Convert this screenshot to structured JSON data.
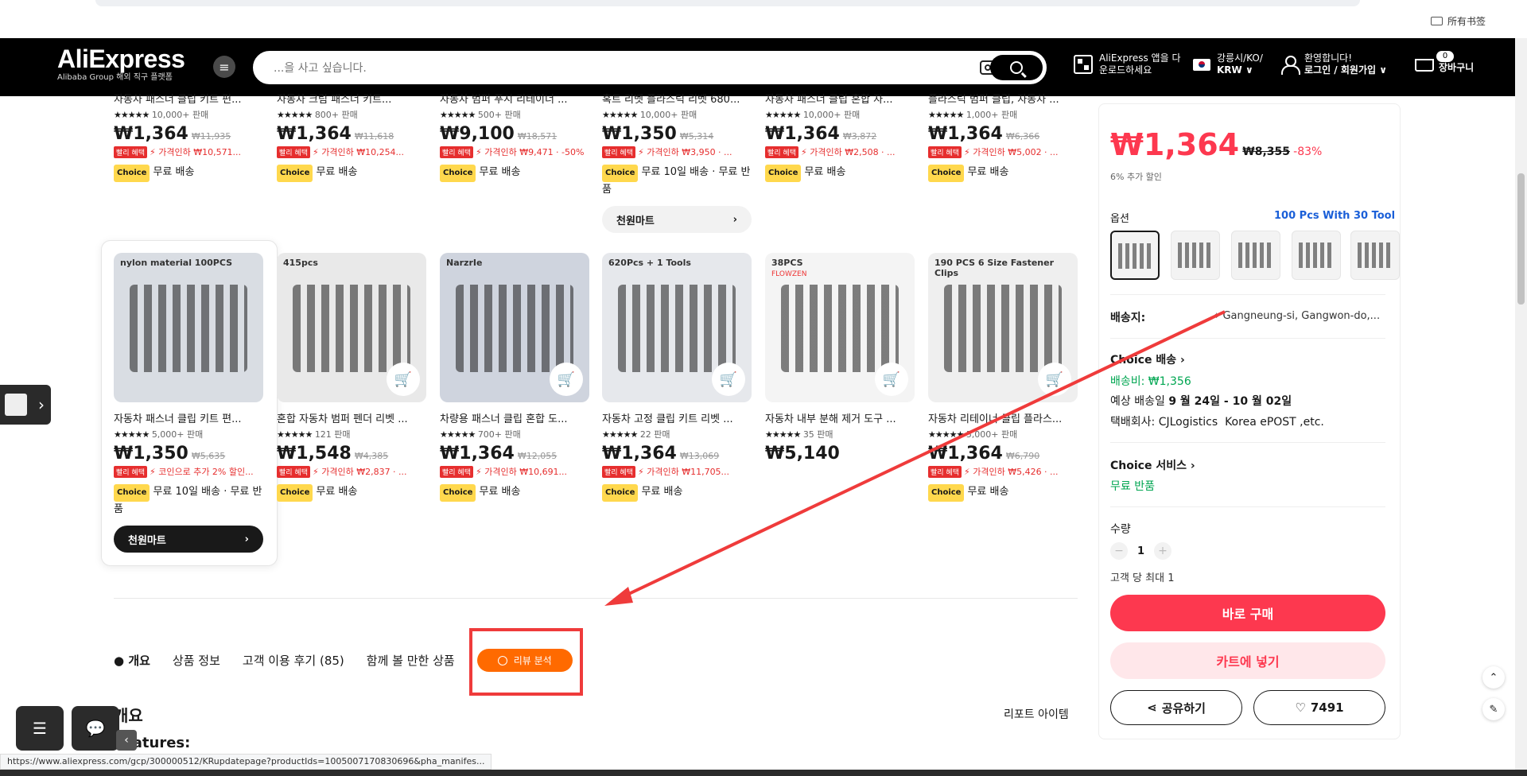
{
  "browser": {
    "bookmarks_folder": "所有书签"
  },
  "header": {
    "logo": "AliExpress",
    "logo_sub": "Alibaba Group 해외 직구 플랫폼",
    "search_placeholder": "...을 사고 싶습니다.",
    "app_line1": "AliExpress 앱을 다",
    "app_line2": "운로드하세요",
    "region_line1": "강릉시/KO/",
    "region_line2": "KRW ∨",
    "welcome": "환영합니다!",
    "login": "로그인 / 회원가입 ∨",
    "cart_count": "0",
    "cart_label": "장바구니"
  },
  "row1": [
    {
      "title": "자동차 패스너 클립 키트 편...",
      "sold": "10,000+ 판매",
      "price": "₩1,364",
      "was": "₩11,935",
      "promo": "가격인하 ₩10,571...",
      "ship": "무료 배송"
    },
    {
      "title": "자동차 크림 패스너 키트...",
      "sold": "800+ 판매",
      "price": "₩1,364",
      "was": "₩11,618",
      "promo": "가격인하 ₩10,254...",
      "ship": "무료 배송"
    },
    {
      "title": "자동차 범퍼 푸시 리테이너 ...",
      "sold": "500+ 판매",
      "price": "₩9,100",
      "was": "₩18,571",
      "promo": "가격인하 ₩9,471 · -50%",
      "ship": "무료 배송"
    },
    {
      "title": "혹트 리벳 플라스틱 리벳 680...",
      "sold": "10,000+ 판매",
      "price": "₩1,350",
      "was": "₩5,314",
      "promo": "가격인하 ₩3,950 · ...",
      "ship": "무료 10일 배송 · 무료 반품",
      "store": "천원마트"
    },
    {
      "title": "자동차 패스너 클립 혼합 자...",
      "sold": "10,000+ 판매",
      "price": "₩1,364",
      "was": "₩3,872",
      "promo": "가격인하 ₩2,508 · ...",
      "ship": "무료 배송"
    },
    {
      "title": "플라스틱 범퍼 클립, 자동차 ...",
      "sold": "1,000+ 판매",
      "price": "₩1,364",
      "was": "₩6,366",
      "promo": "가격인하 ₩5,002 · ...",
      "ship": "무료 배송"
    }
  ],
  "row2": [
    {
      "title": "자동차 패스너 클립 키트 편...",
      "sold": "5,000+ 판매",
      "price": "₩1,350",
      "was": "₩5,635",
      "promo": "코인으로 추가 2% 할인...",
      "ship": "무료 10일 배송 · 무료 반품",
      "store": "천원마트",
      "img_text": "nylon material 100PCS"
    },
    {
      "title": "혼합 자동차 범퍼 펜더 리벳 ...",
      "sold": "121 판매",
      "price": "₩1,548",
      "was": "₩4,385",
      "promo": "가격인하 ₩2,837 · ...",
      "ship": "무료 배송",
      "img_text": "415pcs"
    },
    {
      "title": "차량용 패스너 클립 혼합 도...",
      "sold": "700+ 판매",
      "price": "₩1,364",
      "was": "₩12,055",
      "promo": "가격인하 ₩10,691...",
      "ship": "무료 배송",
      "img_text": "NarzrIe"
    },
    {
      "title": "자동차 고정 클립 키트 리벳 ...",
      "sold": "22 판매",
      "price": "₩1,364",
      "was": "₩13,069",
      "promo": "가격인하 ₩11,705...",
      "ship": "무료 배송",
      "img_text": "620Pcs + 1 Tools"
    },
    {
      "title": "자동차 내부 분해 제거 도구 ...",
      "sold": "35 판매",
      "price": "₩5,140",
      "img_text": "38PCS",
      "brand_text": "FLOWZEN"
    },
    {
      "title": "자동차 리테이너 클립 플라스...",
      "sold": "5,000+ 판매",
      "price": "₩1,364",
      "was": "₩6,790",
      "promo": "가격인하 ₩5,426 · ...",
      "ship": "무료 배송",
      "img_text": "190 PCS  6 Size Fastener Clips"
    }
  ],
  "badges": {
    "sale": "빨리 혜택",
    "choice": "Choice",
    "stars": "★★★★★"
  },
  "tabs": {
    "overview": "개요",
    "info": "상품 정보",
    "reviews": "고객 이용 후기 (85)",
    "related": "함께 볼 만한 상품",
    "analysis": "리뷰 분석"
  },
  "section": {
    "heading": "개요",
    "report": "리포트 아이템",
    "features": "Features:"
  },
  "panel": {
    "price": "₩1,364",
    "was": "₩8,355",
    "off": "-83%",
    "extra": "6% 추가 할인",
    "option_label": "옵션",
    "option_value": "100 Pcs With 30 Tool",
    "ship_to_label": "배송지:",
    "ship_to": "Gangneung-si, Gangwon-do,...",
    "choice_ship": "Choice 배송 ›",
    "ship_fee": "배송비: ₩1,356",
    "eta_label": "예상 배송일",
    "eta": "9 월 24일 - 10 월 02일",
    "carrier_label": "택배회사:",
    "carrier1": "CJLogistics",
    "carrier2": "Korea ePOST ,etc.",
    "choice_service": "Choice 서비스 ›",
    "free_return": "무료 반품",
    "qty_label": "수량",
    "qty": "1",
    "limit": "고객 당 최대 1",
    "buy": "바로 구매",
    "cart": "카트에 넣기",
    "share": "공유하기",
    "wish": "7491"
  },
  "status_url": "https://www.aliexpress.com/gcp/300000512/KRupdatepage?productIds=1005007170830696&pha_manifes..."
}
